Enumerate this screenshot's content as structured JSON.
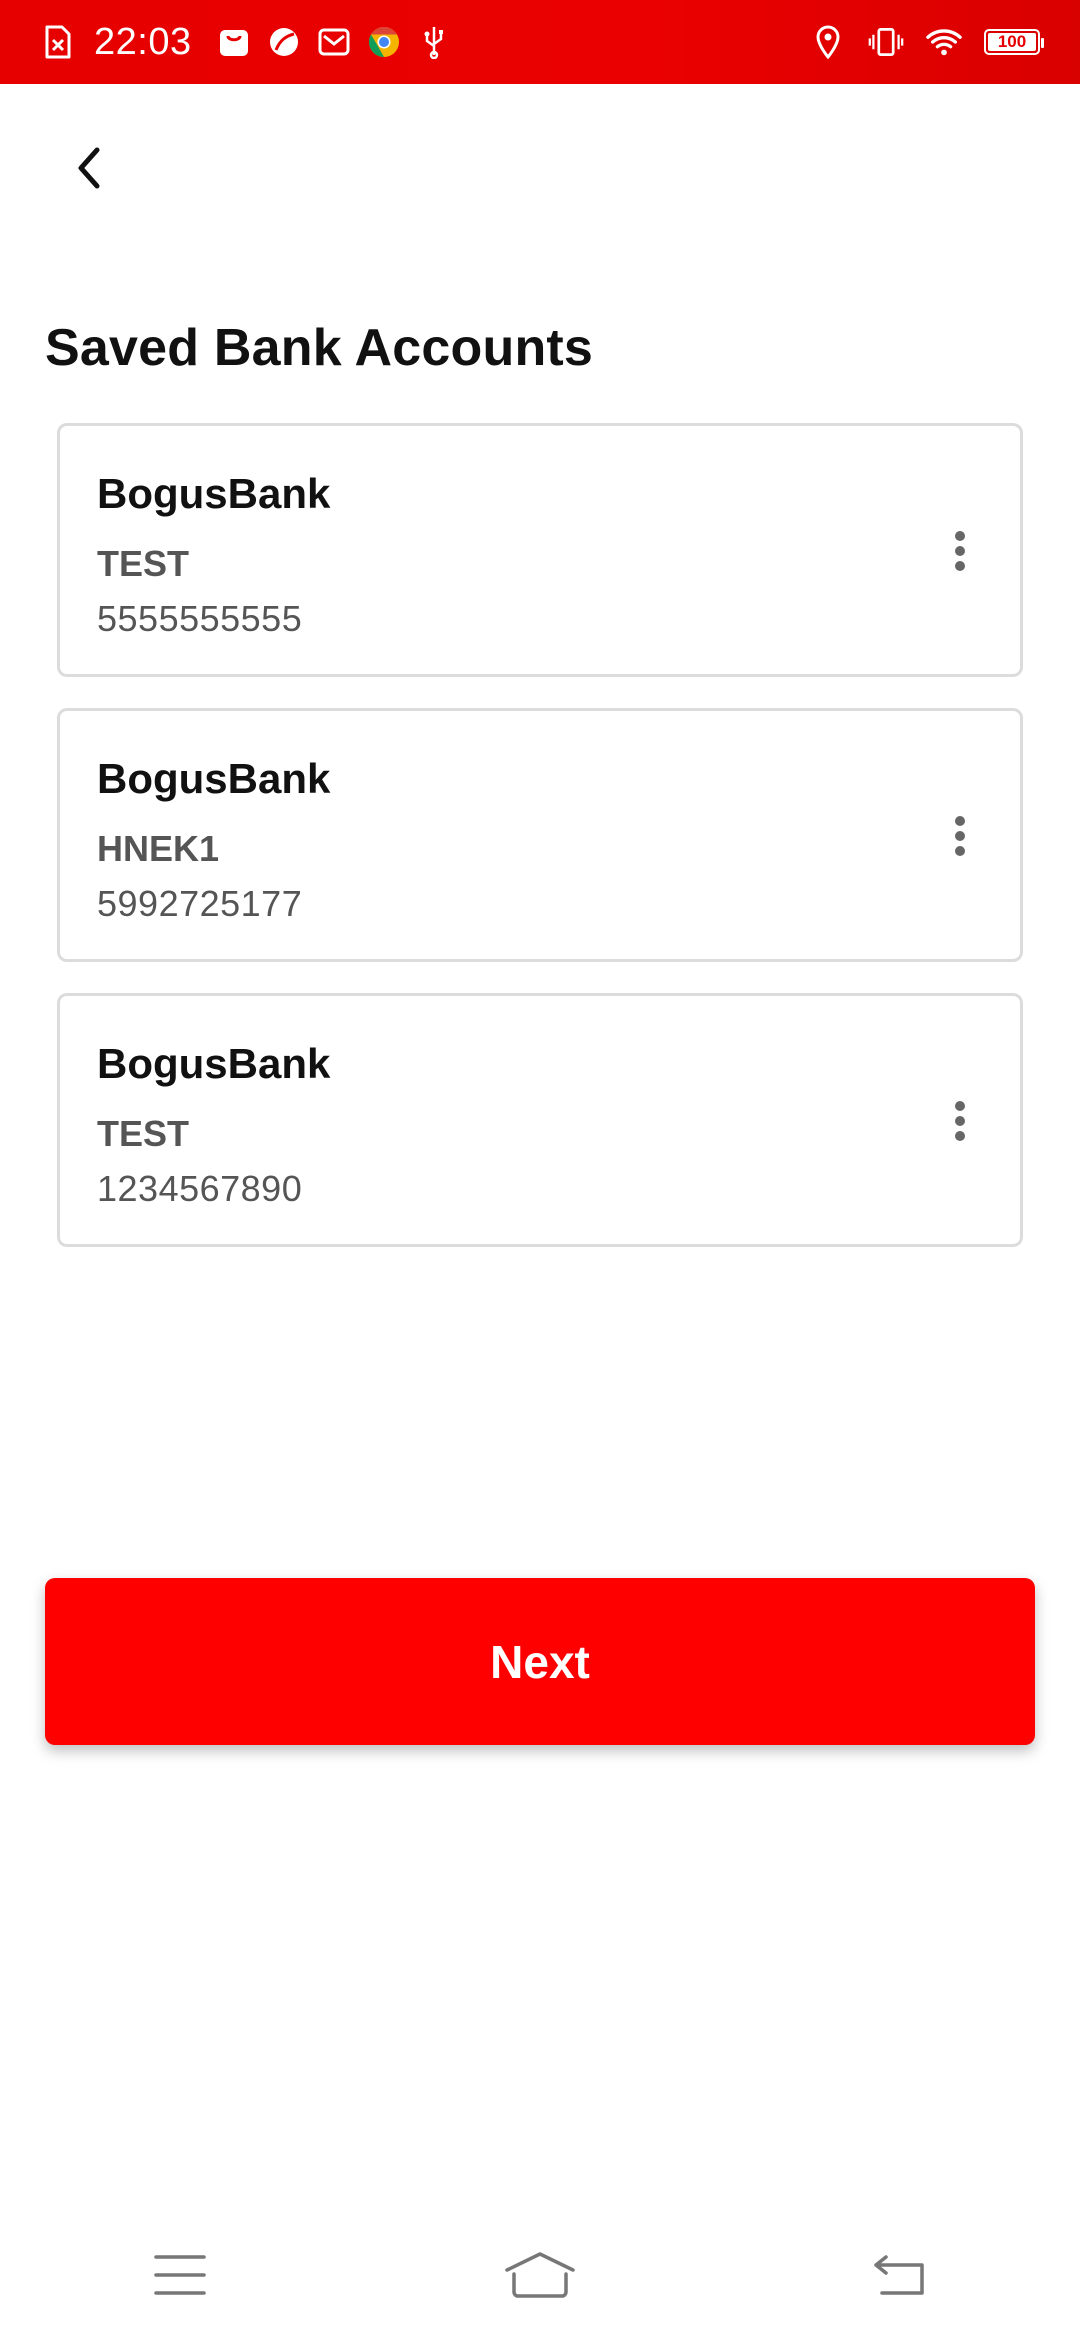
{
  "status_bar": {
    "time": "22:03",
    "battery": "100",
    "left_icons": [
      "sim-error-icon",
      "shopping-bag-icon",
      "leaf-icon",
      "mail-icon",
      "chrome-icon",
      "usb-icon"
    ],
    "right_icons": [
      "location-icon",
      "vibrate-icon",
      "wifi-icon",
      "battery-icon"
    ],
    "background": "#e60000"
  },
  "header": {
    "back_icon": "chevron-left-icon"
  },
  "page": {
    "title": "Saved Bank Accounts"
  },
  "accounts": [
    {
      "bank": "BogusBank",
      "name": "TEST",
      "number": "5555555555",
      "menu_icon": "more-vertical-icon"
    },
    {
      "bank": "BogusBank",
      "name": "HNEK1",
      "number": "5992725177",
      "menu_icon": "more-vertical-icon"
    },
    {
      "bank": "BogusBank",
      "name": "TEST",
      "number": "1234567890",
      "menu_icon": "more-vertical-icon"
    }
  ],
  "actions": {
    "next_label": "Next",
    "next_color": "#ff0000"
  },
  "nav_bar": {
    "items": [
      "menu-icon",
      "home-icon",
      "back-icon"
    ]
  }
}
